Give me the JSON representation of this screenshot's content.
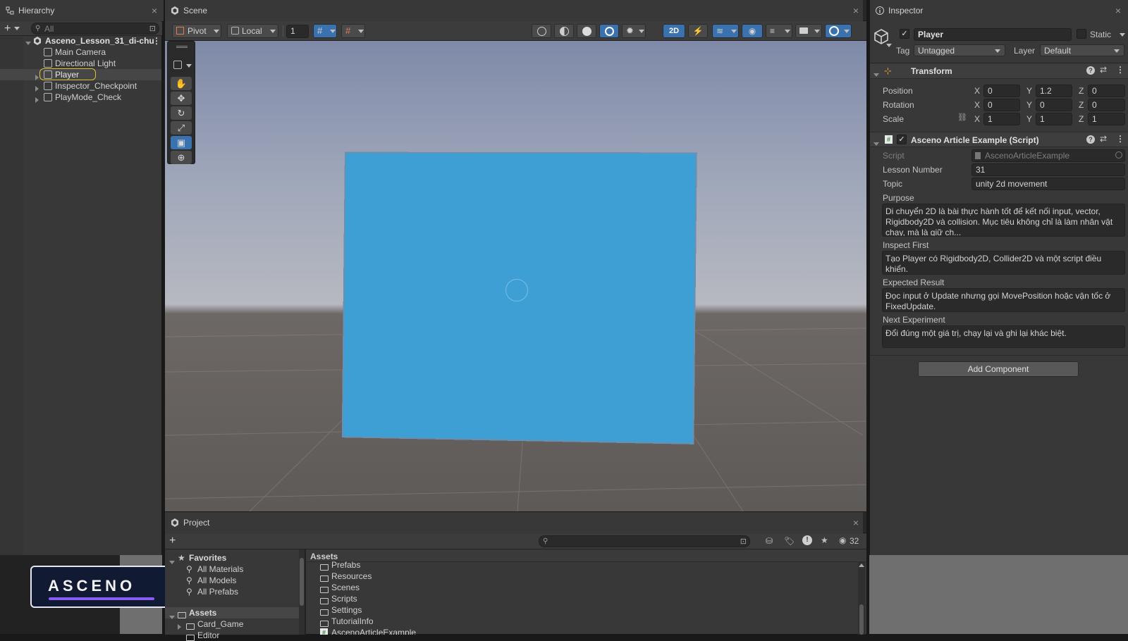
{
  "hierarchy": {
    "tab_title": "Hierarchy",
    "search_placeholder": "All",
    "scene_name": "Asceno_Lesson_31_di-chu",
    "objects": [
      {
        "label": "Main Camera"
      },
      {
        "label": "Directional Light"
      },
      {
        "label": "Player",
        "selected": true
      },
      {
        "label": "Inspector_Checkpoint"
      },
      {
        "label": "PlayMode_Check"
      }
    ]
  },
  "scene": {
    "tab_title": "Scene",
    "pivot_label": "Pivot",
    "local_label": "Local",
    "grid_value": "1",
    "mode_2d_label": "2D"
  },
  "inspector": {
    "tab_title": "Inspector",
    "object_name": "Player",
    "static_label": "Static",
    "tag_label": "Tag",
    "tag_value": "Untagged",
    "layer_label": "Layer",
    "layer_value": "Default",
    "transform": {
      "title": "Transform",
      "position_label": "Position",
      "rotation_label": "Rotation",
      "scale_label": "Scale",
      "axis_x": "X",
      "axis_y": "Y",
      "axis_z": "Z",
      "position": {
        "x": "0",
        "y": "1.2",
        "z": "0"
      },
      "rotation": {
        "x": "0",
        "y": "0",
        "z": "0"
      },
      "scale": {
        "x": "1",
        "y": "1",
        "z": "1"
      }
    },
    "script_component": {
      "title": "Asceno Article Example (Script)",
      "script_label": "Script",
      "script_value": "AscenoArticleExample",
      "lesson_number_label": "Lesson Number",
      "lesson_number_value": "31",
      "topic_label": "Topic",
      "topic_value": "unity 2d movement",
      "purpose_label": "Purpose",
      "purpose_value": "Di chuyển 2D là bài thực hành tốt để kết nối input, vector, Rigidbody2D và collision. Mục tiêu không chỉ là làm nhân vật chạy, mà là giữ ch...",
      "inspect_first_label": "Inspect First",
      "inspect_first_value": "Tạo Player có Rigidbody2D, Collider2D và một script điều khiển.",
      "expected_result_label": "Expected Result",
      "expected_result_value": "Đọc input ở Update nhưng gọi MovePosition hoặc vận tốc ở FixedUpdate.",
      "next_experiment_label": "Next Experiment",
      "next_experiment_value": "Đổi đúng một giá trị, chạy lại và ghi lại khác biệt."
    },
    "add_component_label": "Add Component"
  },
  "project": {
    "tab_title": "Project",
    "hidden_count": "32",
    "favorites_label": "Favorites",
    "favorites": [
      "All Materials",
      "All Models",
      "All Prefabs"
    ],
    "assets_label": "Assets",
    "asset_tree": [
      "Card_Game",
      "Editor"
    ],
    "breadcrumb": "Assets",
    "asset_items": [
      {
        "label": "Prefabs",
        "type": "folder"
      },
      {
        "label": "Resources",
        "type": "folder"
      },
      {
        "label": "Scenes",
        "type": "folder"
      },
      {
        "label": "Scripts",
        "type": "folder"
      },
      {
        "label": "Settings",
        "type": "folder"
      },
      {
        "label": "TutorialInfo",
        "type": "folder"
      },
      {
        "label": "AscenoArticleExample",
        "type": "script"
      }
    ]
  },
  "brand": {
    "logo_text": "ASCENO",
    "accent": "#8a5cf6"
  },
  "colors": {
    "player_quad": "#3d9fd4",
    "selection_outline": "#d8c43a",
    "accent_blue": "#3a72b0"
  }
}
